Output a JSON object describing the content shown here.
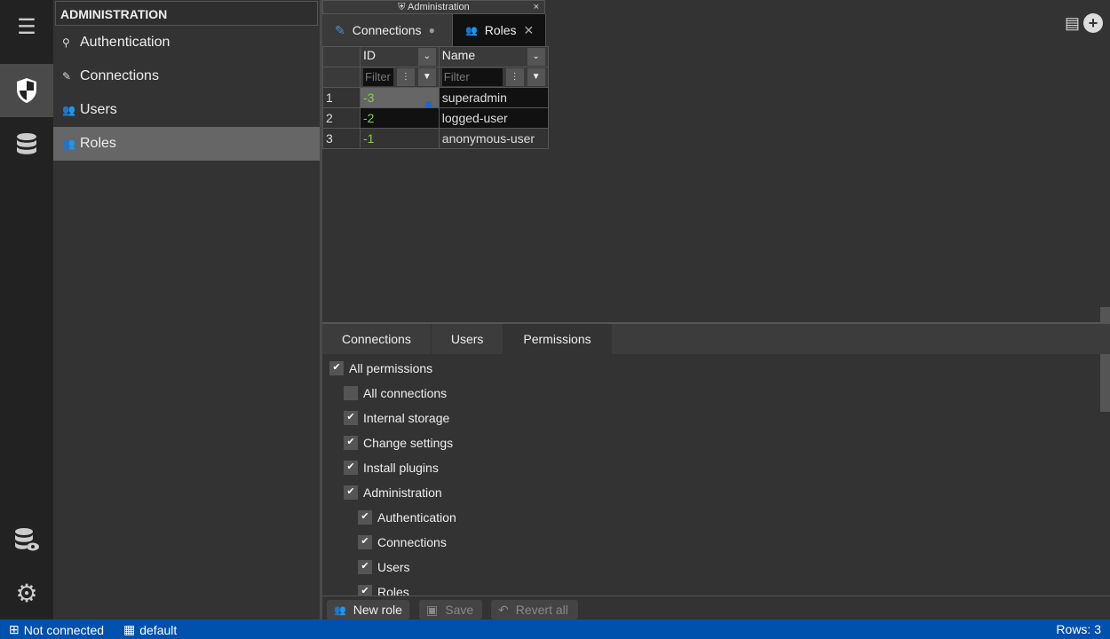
{
  "iconbar": {
    "items": [
      {
        "icon": "menu-icon"
      },
      {
        "icon": "shield-icon",
        "active": true
      },
      {
        "icon": "database-icon"
      },
      {
        "icon": "database-view-icon"
      },
      {
        "icon": "gear-icon"
      }
    ]
  },
  "sidebar": {
    "header": "ADMINISTRATION",
    "items": [
      {
        "label": "Authentication",
        "icon": "authentication-icon"
      },
      {
        "label": "Connections",
        "icon": "plug-icon"
      },
      {
        "label": "Users",
        "icon": "users-icon"
      },
      {
        "label": "Roles",
        "icon": "roles-icon",
        "active": true
      }
    ]
  },
  "tabgroup": {
    "title": "Administration",
    "tabs": [
      {
        "label": "Connections",
        "modified": true
      },
      {
        "label": "Roles",
        "active": true
      }
    ]
  },
  "grid": {
    "columns": [
      "ID",
      "Name"
    ],
    "filter_placeholder": "Filter",
    "rows": [
      {
        "n": "1",
        "id": "-3",
        "name": "superadmin"
      },
      {
        "n": "2",
        "id": "-2",
        "name": "logged-user"
      },
      {
        "n": "3",
        "id": "-1",
        "name": "anonymous-user"
      }
    ]
  },
  "bottom_tabs": [
    {
      "label": "Connections"
    },
    {
      "label": "Users"
    },
    {
      "label": "Permissions",
      "active": true
    }
  ],
  "permissions": [
    {
      "label": "All permissions",
      "checked": true,
      "level": 0
    },
    {
      "label": "All connections",
      "checked": false,
      "level": 1
    },
    {
      "label": "Internal storage",
      "checked": true,
      "level": 1
    },
    {
      "label": "Change settings",
      "checked": true,
      "level": 1
    },
    {
      "label": "Install plugins",
      "checked": true,
      "level": 1
    },
    {
      "label": "Administration",
      "checked": true,
      "level": 1
    },
    {
      "label": "Authentication",
      "checked": true,
      "level": 2
    },
    {
      "label": "Connections",
      "checked": true,
      "level": 2
    },
    {
      "label": "Users",
      "checked": true,
      "level": 2
    },
    {
      "label": "Roles",
      "checked": true,
      "level": 2
    }
  ],
  "toolbar": {
    "new_role": "New role",
    "save": "Save",
    "revert": "Revert all"
  },
  "status": {
    "connection": "Not connected",
    "schema": "default",
    "rows": "Rows: 3"
  },
  "colors": {
    "status_bar": "#0050ad",
    "accent": "#4a90d9",
    "id_value": "#88cc44"
  }
}
